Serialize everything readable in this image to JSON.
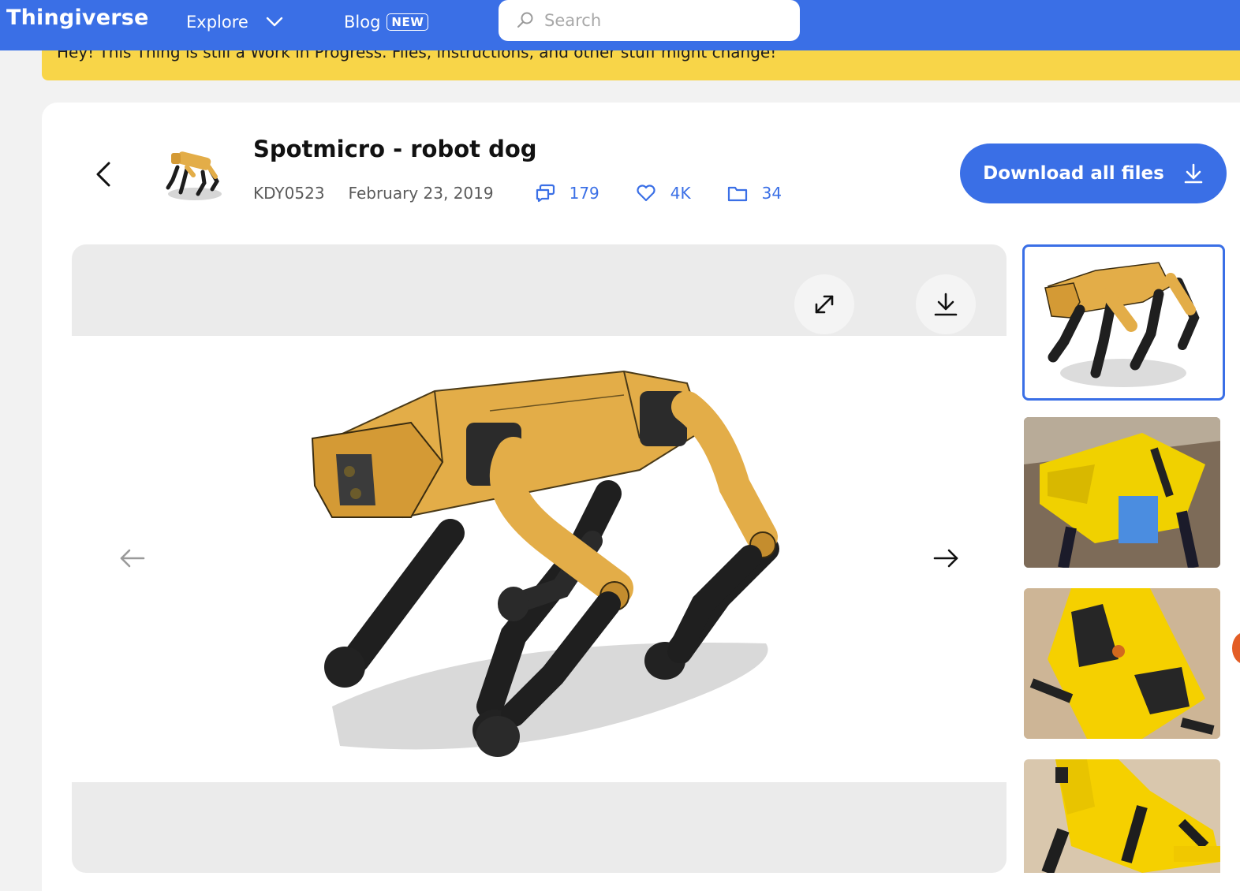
{
  "nav": {
    "logo": "Thingiverse",
    "explore_label": "Explore",
    "blog_label": "Blog",
    "blog_badge": "NEW",
    "search_placeholder": "Search"
  },
  "banner": {
    "text": "Hey! This Thing is still a Work in Progress. Files, instructions, and other stuff might change!"
  },
  "thing": {
    "title": "Spotmicro - robot dog",
    "author": "KDY0523",
    "date": "February 23, 2019",
    "comments": "179",
    "likes": "4K",
    "files": "34"
  },
  "actions": {
    "download_all_label": "Download all files"
  },
  "gallery": {
    "thumbnail_count": 4,
    "active_index": 0
  },
  "colors": {
    "brand_blue": "#3a6fe6",
    "banner_yellow": "#f8d548",
    "robot_yellow": "#e3ad48"
  }
}
